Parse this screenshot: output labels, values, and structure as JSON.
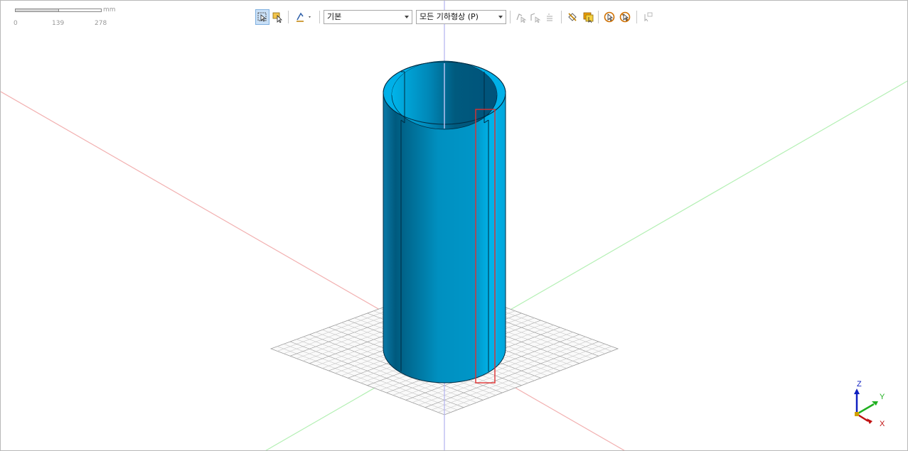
{
  "scale_bar": {
    "unit": "mm",
    "ticks": [
      "0",
      "139",
      "278"
    ]
  },
  "toolbar": {
    "buttons": [
      {
        "name": "select-mode-button",
        "icon": "select-box-icon",
        "active": true
      },
      {
        "name": "select-type-button",
        "icon": "select-cursor-icon",
        "active": false
      },
      {
        "name": "direction-button",
        "icon": "direction-arrow-icon",
        "active": false
      }
    ],
    "filter_combo": {
      "value": "기본"
    },
    "geometry_combo": {
      "value": "모든 기하형상 (P)"
    },
    "disabled_buttons": [
      {
        "name": "node-select-button",
        "icon": "node-cursor-icon"
      },
      {
        "name": "edge-select-button",
        "icon": "edge-cursor-icon"
      },
      {
        "name": "list-button",
        "icon": "list-icon"
      }
    ],
    "tools": [
      {
        "name": "hide-button",
        "icon": "hide-icon"
      },
      {
        "name": "show-selected-button",
        "icon": "box-cursor-icon"
      },
      {
        "name": "pick-button",
        "icon": "pick-cursor-icon"
      },
      {
        "name": "pick-cancel-button",
        "icon": "pick-cancel-icon"
      },
      {
        "name": "measure-button",
        "icon": "measure-icon"
      }
    ]
  },
  "colors": {
    "cylinder_dark": "#005a7e",
    "cylinder_mid": "#0096c8",
    "cylinder_light": "#00b8ee",
    "x_axis": "#f0a0a0",
    "y_axis": "#a0f0a0",
    "z_axis": "#a0a0f0",
    "selection": "#e03030",
    "grid": "#c8c8c8"
  },
  "triad": {
    "z_label": "Z",
    "y_label": "Y",
    "x_label": "X"
  }
}
